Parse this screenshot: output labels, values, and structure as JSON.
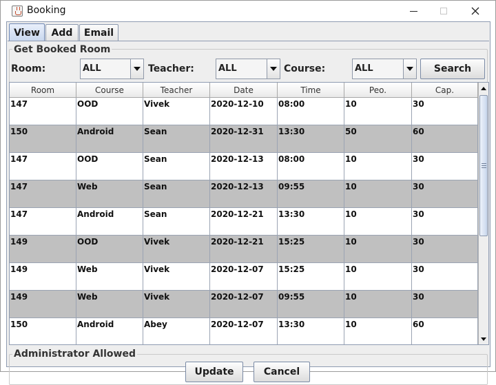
{
  "window": {
    "title": "Booking",
    "app_icon": "java-cup-icon",
    "controls": [
      "minimize-icon",
      "maximize-icon",
      "close-icon"
    ]
  },
  "tabs": [
    {
      "label": "View",
      "active": true
    },
    {
      "label": "Add",
      "active": false
    },
    {
      "label": "Email",
      "active": false
    }
  ],
  "search_group": {
    "title": "Get Booked Room",
    "room_label": "Room:",
    "room_value": "ALL",
    "teacher_label": "Teacher:",
    "teacher_value": "ALL",
    "course_label": "Course:",
    "course_value": "ALL",
    "search_button": "Search"
  },
  "table": {
    "columns": [
      "Room",
      "Course",
      "Teacher",
      "Date",
      "Time",
      "Peo.",
      "Cap."
    ],
    "rows": [
      [
        "147",
        "OOD",
        "Vivek",
        "2020-12-10",
        "08:00",
        "10",
        "30"
      ],
      [
        "150",
        "Android",
        "Sean",
        "2020-12-31",
        "13:30",
        "50",
        "60"
      ],
      [
        "147",
        "OOD",
        "Sean",
        "2020-12-13",
        "08:00",
        "10",
        "30"
      ],
      [
        "147",
        "Web",
        "Sean",
        "2020-12-13",
        "09:55",
        "10",
        "30"
      ],
      [
        "147",
        "Android",
        "Sean",
        "2020-12-21",
        "13:30",
        "10",
        "30"
      ],
      [
        "149",
        "OOD",
        "Vivek",
        "2020-12-21",
        "15:25",
        "10",
        "30"
      ],
      [
        "149",
        "Web",
        "Vivek",
        "2020-12-07",
        "15:25",
        "10",
        "30"
      ],
      [
        "149",
        "Web",
        "Vivek",
        "2020-12-07",
        "09:55",
        "10",
        "30"
      ],
      [
        "150",
        "Android",
        "Abey",
        "2020-12-07",
        "13:30",
        "10",
        "60"
      ]
    ],
    "alt_row_color": "#c0c0c0"
  },
  "admin_group": {
    "title": "Administrator Allowed",
    "update_button": "Update",
    "cancel_button": "Cancel"
  }
}
